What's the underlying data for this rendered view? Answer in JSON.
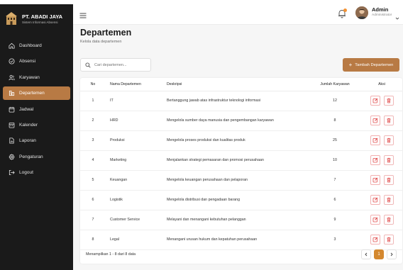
{
  "brand": {
    "title": "PT. ABADI JAYA",
    "subtitle": "Sistem Informasi Absensi"
  },
  "sidebar": {
    "items": [
      {
        "label": "Dashboard",
        "icon": "home-icon",
        "active": false
      },
      {
        "label": "Absensi",
        "icon": "check-circle-icon",
        "active": false
      },
      {
        "label": "Karyawan",
        "icon": "users-icon",
        "active": false
      },
      {
        "label": "Departemen",
        "icon": "building-icon",
        "active": true
      },
      {
        "label": "Jadwal",
        "icon": "calendar-icon",
        "active": false
      },
      {
        "label": "Kalender",
        "icon": "calendar-grid-icon",
        "active": false
      },
      {
        "label": "Laporan",
        "icon": "report-icon",
        "active": false
      },
      {
        "label": "Pengaturan",
        "icon": "gear-icon",
        "active": false
      },
      {
        "label": "Logout",
        "icon": "logout-icon",
        "active": false
      }
    ]
  },
  "topbar": {
    "user_name": "Admin",
    "user_role": "Administrator"
  },
  "page": {
    "title": "Departemen",
    "subtitle": "Kelola data departemen",
    "search_placeholder": "Cari departemen...",
    "add_label": "Tambah Departemen"
  },
  "table": {
    "headers": {
      "no": "No",
      "name": "Nama Departemen",
      "desc": "Deskripsi",
      "count": "Jumlah Karyawan",
      "actions": "Aksi"
    },
    "rows": [
      {
        "no": "1",
        "name": "IT",
        "desc": "Bertanggung jawab atas infrastruktur teknologi informasi",
        "count": "12"
      },
      {
        "no": "2",
        "name": "HRD",
        "desc": "Mengelola sumber daya manusia dan pengembangan karyawan",
        "count": "8"
      },
      {
        "no": "3",
        "name": "Produksi",
        "desc": "Mengelola proses produksi dan kualitas produk",
        "count": "25"
      },
      {
        "no": "4",
        "name": "Marketing",
        "desc": "Menjalankan strategi pemasaran dan promosi perusahaan",
        "count": "10"
      },
      {
        "no": "5",
        "name": "Keuangan",
        "desc": "Mengelola keuangan perusahaan dan pelaporan",
        "count": "7"
      },
      {
        "no": "6",
        "name": "Logistik",
        "desc": "Mengelola distribusi dan pengadaan barang",
        "count": "6"
      },
      {
        "no": "7",
        "name": "Customer Service",
        "desc": "Melayani dan menangani kebutuhan pelanggan",
        "count": "9"
      },
      {
        "no": "8",
        "name": "Legal",
        "desc": "Menangani urusan hukum dan kepatuhan perusahaan",
        "count": "3"
      }
    ]
  },
  "footer": {
    "info": "Menampilkan 1 - 8 dari 8 data",
    "current_page": "1"
  },
  "colors": {
    "sidebar_bg": "#1a1a1a",
    "accent": "#b87a44",
    "danger": "#e04848",
    "page_active": "#d4882f"
  }
}
